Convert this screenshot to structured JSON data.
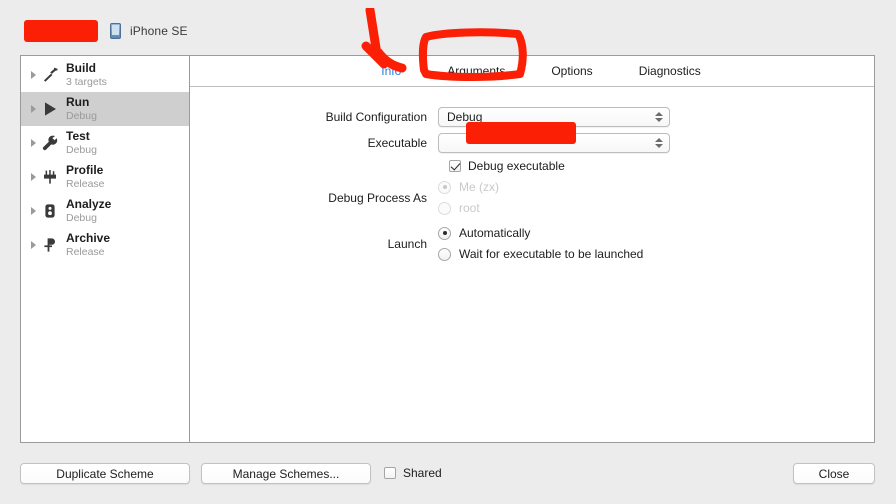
{
  "window": {
    "scheme_name_redacted": true,
    "device_icon": "iphone-device-icon",
    "device_label": "iPhone SE"
  },
  "sidebar": {
    "items": [
      {
        "title": "Build",
        "subtitle": "3 targets",
        "icon": "hammer-icon",
        "selected": false
      },
      {
        "title": "Run",
        "subtitle": "Debug",
        "icon": "play-icon",
        "selected": true
      },
      {
        "title": "Test",
        "subtitle": "Debug",
        "icon": "wrench-icon",
        "selected": false
      },
      {
        "title": "Profile",
        "subtitle": "Release",
        "icon": "gauge-icon",
        "selected": false
      },
      {
        "title": "Analyze",
        "subtitle": "Debug",
        "icon": "analyze-icon",
        "selected": false
      },
      {
        "title": "Archive",
        "subtitle": "Release",
        "icon": "archive-icon",
        "selected": false
      }
    ]
  },
  "tabs": [
    {
      "label": "Info",
      "active": true
    },
    {
      "label": "Arguments",
      "active": false
    },
    {
      "label": "Options",
      "active": false
    },
    {
      "label": "Diagnostics",
      "active": false
    }
  ],
  "form": {
    "build_configuration": {
      "label": "Build Configuration",
      "value": "Debug"
    },
    "executable": {
      "label": "Executable",
      "value": "",
      "redacted": true
    },
    "debug_executable": {
      "label": "Debug executable",
      "checked": true
    },
    "debug_process_as": {
      "label": "Debug Process As",
      "options": [
        {
          "label": "Me (zx)",
          "selected": true,
          "disabled": true
        },
        {
          "label": "root",
          "selected": false,
          "disabled": true
        }
      ]
    },
    "launch": {
      "label": "Launch",
      "options": [
        {
          "label": "Automatically",
          "selected": true,
          "disabled": false
        },
        {
          "label": "Wait for executable to be launched",
          "selected": false,
          "disabled": false
        }
      ]
    }
  },
  "bottom_bar": {
    "duplicate_scheme": "Duplicate Scheme",
    "manage_schemes": "Manage Schemes...",
    "shared_label": "Shared",
    "shared_checked": false,
    "close": "Close"
  },
  "annotations": {
    "color": "#fb1f06",
    "arrow_target": "Arguments",
    "circle_target": "Arguments"
  }
}
